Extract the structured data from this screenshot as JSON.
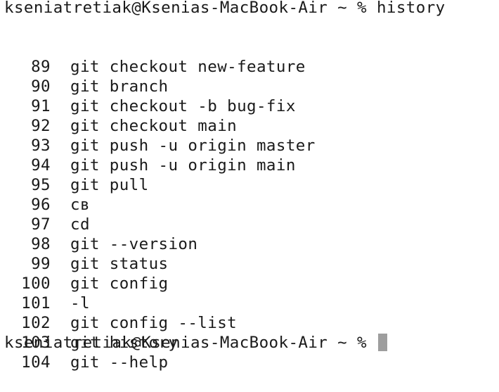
{
  "terminal": {
    "prompt": "kseniatretiak@Ksenias-MacBook-Air ~ % ",
    "first_command": "history",
    "history": [
      {
        "num": "89",
        "cmd": "git checkout new-feature"
      },
      {
        "num": "90",
        "cmd": "git branch"
      },
      {
        "num": "91",
        "cmd": "git checkout -b bug-fix"
      },
      {
        "num": "92",
        "cmd": "git checkout main"
      },
      {
        "num": "93",
        "cmd": "git push -u origin master"
      },
      {
        "num": "94",
        "cmd": "git push -u origin main"
      },
      {
        "num": "95",
        "cmd": "git pull"
      },
      {
        "num": "96",
        "cmd": "cв"
      },
      {
        "num": "97",
        "cmd": "cd"
      },
      {
        "num": "98",
        "cmd": "git --version"
      },
      {
        "num": "99",
        "cmd": "git status"
      },
      {
        "num": "100",
        "cmd": "git config"
      },
      {
        "num": "101",
        "cmd": "-l"
      },
      {
        "num": "102",
        "cmd": "git config --list"
      },
      {
        "num": "103",
        "cmd": "git history"
      },
      {
        "num": "104",
        "cmd": "git --help"
      }
    ],
    "colors": {
      "background": "#ffffff",
      "text": "#1a1a1a",
      "cursor": "#9e9e9e"
    }
  }
}
